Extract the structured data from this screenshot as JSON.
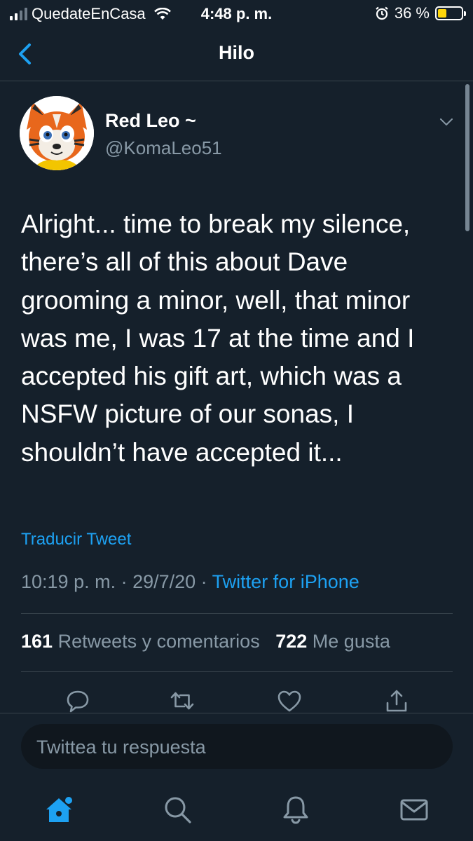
{
  "status_bar": {
    "carrier": "QuedateEnCasa",
    "time": "4:48 p. m.",
    "battery_percent": "36 %",
    "battery_level": 0.36,
    "icons": [
      "signal-icon",
      "wifi-icon",
      "alarm-icon",
      "battery-icon"
    ]
  },
  "nav": {
    "title": "Hilo",
    "back_icon": "chevron-left-icon"
  },
  "tweet": {
    "author_name": "Red Leo ~",
    "author_handle": "@KomaLeo51",
    "text": "Alright... time to break my silence, there’s all of this about Dave grooming a minor, well, that minor was me, I was 17 at the time and I accepted his gift art, which was a NSFW picture of our sonas, I shouldn’t have accepted it...",
    "translate_label": "Traducir Tweet",
    "timestamp": "10:19 p. m. · 29/7/20 · ",
    "source": "Twitter for iPhone",
    "retweets_count": "161",
    "retweets_label": "Retweets y comentarios",
    "likes_count": "722",
    "likes_label": "Me gusta",
    "actions": [
      "reply-icon",
      "retweet-icon",
      "like-icon",
      "share-icon"
    ]
  },
  "reply": {
    "placeholder": "Twittea tu respuesta"
  },
  "tabbar": {
    "items": [
      "home-icon",
      "search-icon",
      "notifications-icon",
      "messages-icon"
    ]
  },
  "colors": {
    "background": "#15202b",
    "accent": "#1da1f2",
    "secondary_text": "#8899a6",
    "divider": "#38444d"
  }
}
